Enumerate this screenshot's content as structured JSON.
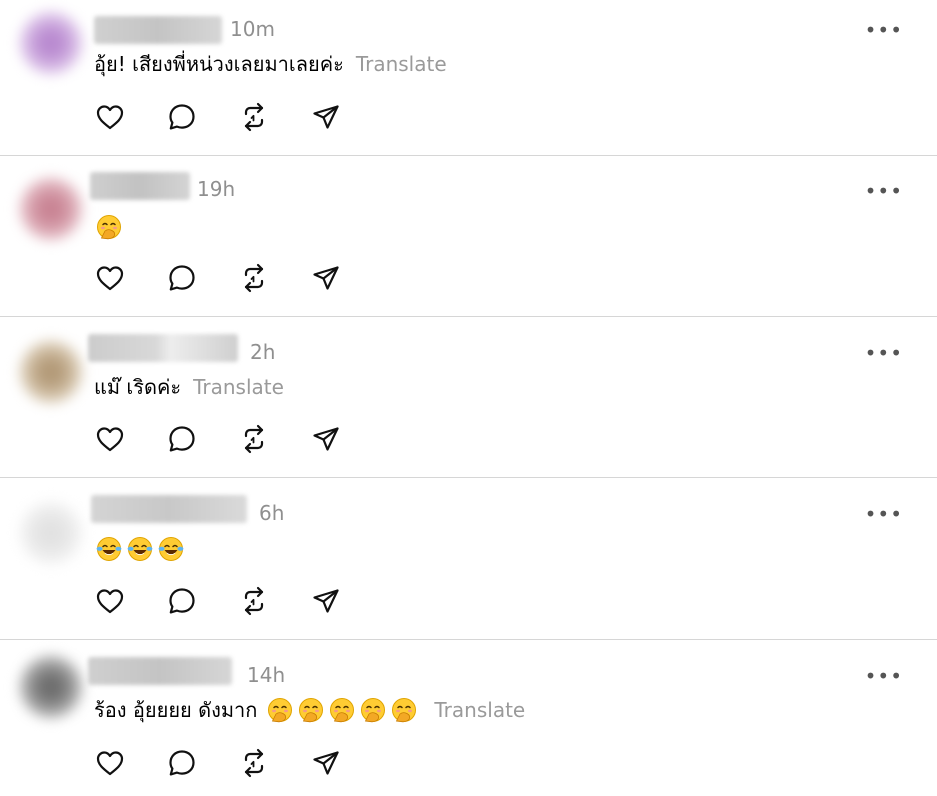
{
  "actions": {
    "like_icon": "heart-icon",
    "reply_icon": "speech-bubble-icon",
    "repost_icon": "repost-icon",
    "share_icon": "paper-plane-icon",
    "more_label": "•••"
  },
  "posts": [
    {
      "time": "10m",
      "text": "อุ้ย! เสียงพี่หน่วงเลยมาเลยค่ะ",
      "translate": "Translate",
      "emojis": [],
      "avatar_color": "#b98ad0"
    },
    {
      "time": "19h",
      "text": "",
      "translate": "",
      "emojis": [
        "face-with-hand-over-mouth"
      ],
      "avatar_color": "#c98494"
    },
    {
      "time": "2h",
      "text": "แม๊ เริดค่ะ",
      "translate": "Translate",
      "emojis": [],
      "avatar_color": "#b39a78"
    },
    {
      "time": "6h",
      "text": "",
      "translate": "",
      "emojis": [
        "face-with-tears-of-joy",
        "face-with-tears-of-joy",
        "face-with-tears-of-joy"
      ],
      "avatar_color": "#e2e2e2"
    },
    {
      "time": "14h",
      "text": "ร้อง อุ้ยยยย ดังมาก",
      "translate": "Translate",
      "emojis": [
        "face-with-hand-over-mouth",
        "face-with-hand-over-mouth",
        "face-with-hand-over-mouth",
        "face-with-hand-over-mouth",
        "face-with-hand-over-mouth"
      ],
      "avatar_color": "#6e6e6e"
    }
  ]
}
